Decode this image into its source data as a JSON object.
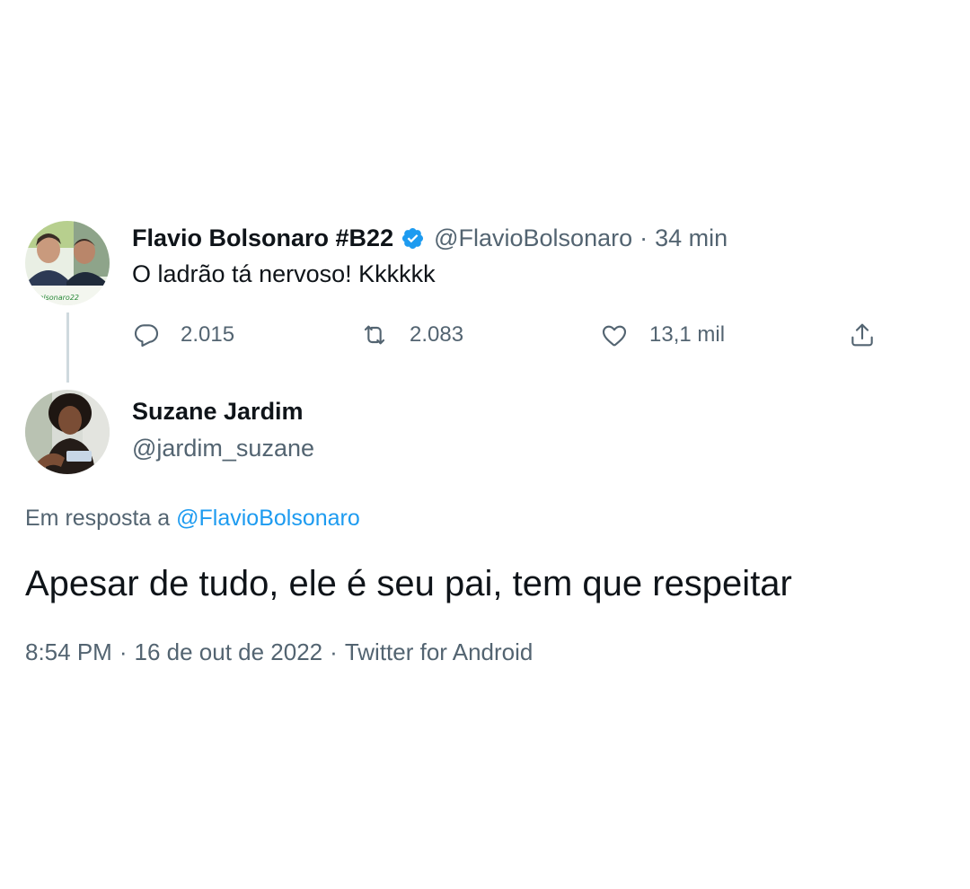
{
  "parent_tweet": {
    "display_name": "Flavio Bolsonaro #B22",
    "handle": "@FlavioBolsonaro",
    "separator": "·",
    "time": "34 min",
    "text": "O ladrão tá nervoso! Kkkkkk",
    "avatar_badge_text": "Bolsonaro22",
    "verified": true,
    "actions": {
      "reply_count": "2.015",
      "retweet_count": "2.083",
      "like_count": "13,1 mil"
    }
  },
  "reply_tweet": {
    "display_name": "Suzane Jardim",
    "handle": "@jardim_suzane",
    "in_reply_to_prefix": "Em resposta a",
    "in_reply_to_handle": "@FlavioBolsonaro",
    "text": "Apesar de tudo, ele é seu pai, tem que respeitar",
    "time": "8:54 PM",
    "date": "16 de out de 2022",
    "source": "Twitter for Android",
    "separator": "·"
  },
  "icons": {
    "verified": "verified-badge-icon",
    "reply": "reply-bubble-icon",
    "retweet": "retweet-icon",
    "like": "heart-icon",
    "share": "share-icon"
  },
  "colors": {
    "text_primary": "#0f1419",
    "text_secondary": "#536471",
    "accent": "#1d9bf0",
    "thread_line": "#cfd9de"
  }
}
